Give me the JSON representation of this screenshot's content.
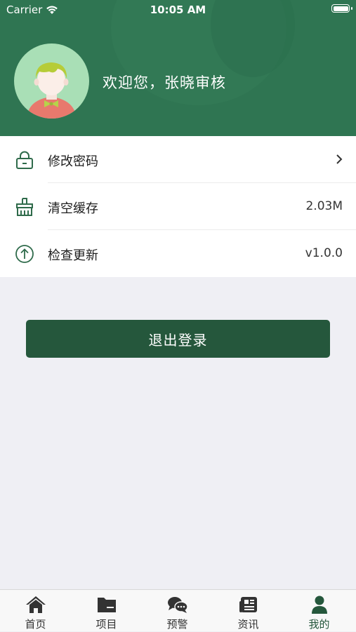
{
  "status": {
    "carrier": "Carrier",
    "time": "10:05 AM"
  },
  "header": {
    "welcome": "欢迎您，张晓审核"
  },
  "menu": [
    {
      "icon": "lock-icon",
      "label": "修改密码",
      "value": ""
    },
    {
      "icon": "broom-icon",
      "label": "清空缓存",
      "value": "2.03M"
    },
    {
      "icon": "upload-icon",
      "label": "检查更新",
      "value": "v1.0.0"
    }
  ],
  "logout_label": "退出登录",
  "tabs": [
    {
      "icon": "home-icon",
      "label": "首页"
    },
    {
      "icon": "folder-icon",
      "label": "项目"
    },
    {
      "icon": "chat-icon",
      "label": "预警"
    },
    {
      "icon": "news-icon",
      "label": "资讯"
    },
    {
      "icon": "person-icon",
      "label": "我的"
    }
  ],
  "colors": {
    "header_green": "#2f7552",
    "accent_dark_green": "#25573c"
  }
}
